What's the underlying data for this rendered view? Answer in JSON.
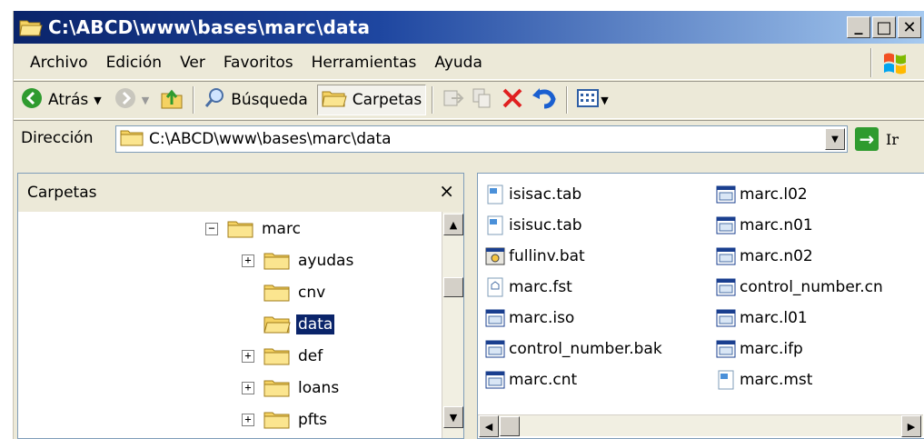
{
  "window": {
    "title": "C:\\ABCD\\www\\bases\\marc\\data",
    "controls": [
      "_",
      "□",
      "✕"
    ]
  },
  "menu": {
    "items": [
      "Archivo",
      "Edición",
      "Ver",
      "Favoritos",
      "Herramientas",
      "Ayuda"
    ]
  },
  "toolbar": {
    "back_label": "Atrás",
    "search_label": "Búsqueda",
    "folders_label": "Carpetas"
  },
  "address": {
    "label": "Dirección",
    "value": "C:\\ABCD\\www\\bases\\marc\\data",
    "go_label": "Ir"
  },
  "folders": {
    "header": "Carpetas",
    "close": "×",
    "tree": [
      {
        "label": "marc",
        "expander": "−",
        "selected": false
      },
      {
        "label": "ayudas",
        "expander": "+",
        "selected": false
      },
      {
        "label": "cnv",
        "expander": "",
        "selected": false
      },
      {
        "label": "data",
        "expander": "",
        "selected": true
      },
      {
        "label": "def",
        "expander": "+",
        "selected": false
      },
      {
        "label": "loans",
        "expander": "+",
        "selected": false
      },
      {
        "label": "pfts",
        "expander": "+",
        "selected": false
      }
    ]
  },
  "files": {
    "column1": [
      {
        "name": "isisac.tab",
        "icon": "text-file-icon"
      },
      {
        "name": "isisuc.tab",
        "icon": "text-file-icon"
      },
      {
        "name": "fullinv.bat",
        "icon": "batch-file-icon"
      },
      {
        "name": "marc.fst",
        "icon": "doc-file-icon"
      },
      {
        "name": "marc.iso",
        "icon": "app-file-icon"
      },
      {
        "name": "control_number.bak",
        "icon": "app-file-icon"
      },
      {
        "name": "marc.cnt",
        "icon": "app-file-icon"
      }
    ],
    "column2": [
      {
        "name": "marc.l02",
        "icon": "app-file-icon"
      },
      {
        "name": "marc.n01",
        "icon": "app-file-icon"
      },
      {
        "name": "marc.n02",
        "icon": "app-file-icon"
      },
      {
        "name": "control_number.cn",
        "icon": "app-file-icon"
      },
      {
        "name": "marc.l01",
        "icon": "app-file-icon"
      },
      {
        "name": "marc.ifp",
        "icon": "app-file-icon"
      },
      {
        "name": "marc.mst",
        "icon": "text-file-icon"
      }
    ]
  },
  "colors": {
    "title_bar_start": "#0a246a",
    "title_bar_end": "#a6caf0",
    "chrome": "#ece9d8",
    "selection": "#0a246a",
    "folder": "#f5d262",
    "delete_red": "#e02020",
    "undo_blue": "#1a5fd0",
    "go_green": "#2f9b2f"
  }
}
